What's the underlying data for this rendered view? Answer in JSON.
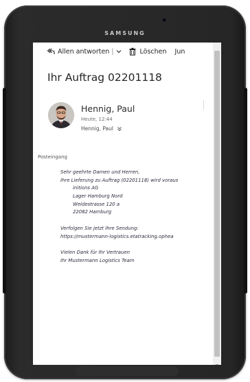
{
  "device": {
    "brand": "SAMSUNG"
  },
  "toolbar": {
    "reply_all_label": "Allen antworten",
    "separator": "|",
    "delete_label": "Löschen",
    "junk_label": "Jun"
  },
  "message": {
    "subject": "Ihr Auftrag 02201118",
    "sender_name": "Hennig, Paul",
    "sent_time": "Heute, 12:44",
    "recipient": "Hennig, Paul",
    "folder": "Posteingang",
    "body": {
      "greeting": "Sehr geehrte Damen und Herren,",
      "delivery_line": "Ihre Lieferung zu Auftrag (02201118) wird voraus",
      "address": [
        "initions AG",
        "Lager Hamburg Nord",
        "Weidestrasse 120 a",
        "22082 Hamburg"
      ],
      "tracking_intro": "Verfolgen Sie jetzt Ihre Sendung:",
      "tracking_link": "https://mustermann-logistics.etatracking.ophea",
      "thanks": "Vielen Dank für Ihr Vertrauen",
      "signature": "Ihr Mustermann Logistics Team"
    }
  },
  "colors": {
    "tablet_frame": "#262626",
    "screen_bg": "#ffffff",
    "text_primary": "#252525",
    "text_secondary": "#6d6d6d",
    "scrollbar_thumb": "#c1c1c1"
  },
  "icons": {
    "reply_all": "reply-all-icon",
    "dropdown": "chevron-down-icon",
    "delete": "trash-icon",
    "expand_recipients": "double-chevron-down-icon",
    "scroll_up": "scroll-up-arrow-icon",
    "scroll_down": "scroll-down-arrow-icon"
  }
}
